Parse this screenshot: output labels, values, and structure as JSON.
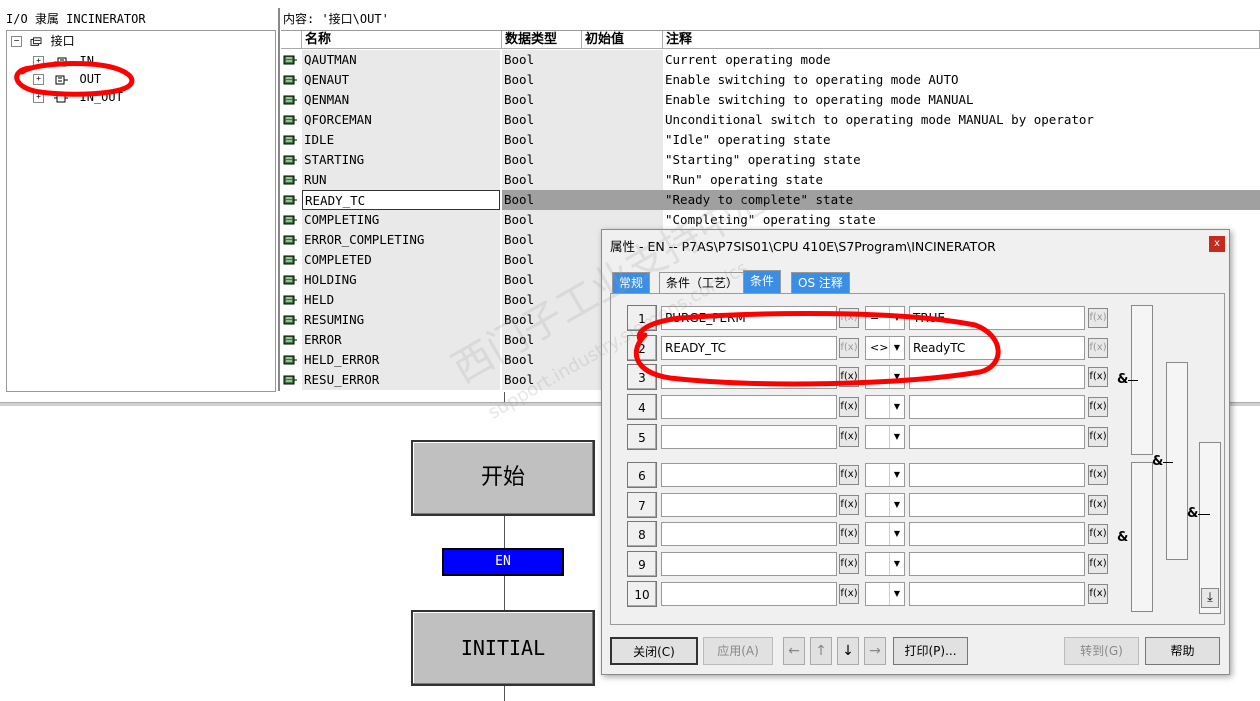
{
  "tree": {
    "header": "I/O 隶属 INCINERATOR",
    "root": "接口",
    "items": [
      "IN",
      "OUT",
      "IN_OUT"
    ]
  },
  "table": {
    "header": "内容: '接口\\OUT'",
    "columns": [
      "名称",
      "数据类型",
      "初始值",
      "注释"
    ],
    "rows": [
      {
        "name": "QAUTMAN",
        "type": "Bool",
        "init": "",
        "comment": "Current operating mode"
      },
      {
        "name": "QENAUT",
        "type": "Bool",
        "init": "",
        "comment": "Enable switching to operating mode AUTO"
      },
      {
        "name": "QENMAN",
        "type": "Bool",
        "init": "",
        "comment": "Enable switching to operating mode MANUAL"
      },
      {
        "name": "QFORCEMAN",
        "type": "Bool",
        "init": "",
        "comment": "Unconditional switch to operating mode MANUAL by operator"
      },
      {
        "name": "IDLE",
        "type": "Bool",
        "init": "",
        "comment": "\"Idle\" operating state"
      },
      {
        "name": "STARTING",
        "type": "Bool",
        "init": "",
        "comment": "\"Starting\" operating state"
      },
      {
        "name": "RUN",
        "type": "Bool",
        "init": "",
        "comment": "\"Run\" operating state"
      },
      {
        "name": "READY_TC",
        "type": "Bool",
        "init": "",
        "comment": "\"Ready to complete\" state"
      },
      {
        "name": "COMPLETING",
        "type": "Bool",
        "init": "",
        "comment": "\"Completing\" operating state"
      },
      {
        "name": "ERROR_COMPLETING",
        "type": "Bool",
        "init": "",
        "comment": ""
      },
      {
        "name": "COMPLETED",
        "type": "Bool",
        "init": "",
        "comment": ""
      },
      {
        "name": "HOLDING",
        "type": "Bool",
        "init": "",
        "comment": ""
      },
      {
        "name": "HELD",
        "type": "Bool",
        "init": "",
        "comment": ""
      },
      {
        "name": "RESUMING",
        "type": "Bool",
        "init": "",
        "comment": ""
      },
      {
        "name": "ERROR",
        "type": "Bool",
        "init": "",
        "comment": ""
      },
      {
        "name": "HELD_ERROR",
        "type": "Bool",
        "init": "",
        "comment": ""
      },
      {
        "name": "RESU_ERROR",
        "type": "Bool",
        "init": "",
        "comment": ""
      }
    ]
  },
  "sfc": {
    "step_start": "开始",
    "transition": "EN",
    "step_initial": "INITIAL"
  },
  "dialog": {
    "title": "属性 -  EN -- P7AS\\P7SIS01\\CPU 410E\\S7Program\\INCINERATOR",
    "close": "x",
    "tabs": [
      "常规",
      "条件（工艺）",
      "条件",
      "OS 注释"
    ],
    "rows": [
      {
        "num": "1",
        "left": "PURGE_PERM",
        "op": "=",
        "right": "TRUE"
      },
      {
        "num": "2",
        "left": "READY_TC",
        "op": "<>",
        "right": "ReadyTC"
      },
      {
        "num": "3",
        "left": "",
        "op": "",
        "right": ""
      },
      {
        "num": "4",
        "left": "",
        "op": "",
        "right": ""
      },
      {
        "num": "5",
        "left": "",
        "op": "",
        "right": ""
      },
      {
        "num": "6",
        "left": "",
        "op": "",
        "right": ""
      },
      {
        "num": "7",
        "left": "",
        "op": "",
        "right": ""
      },
      {
        "num": "8",
        "left": "",
        "op": "",
        "right": ""
      },
      {
        "num": "9",
        "left": "",
        "op": "",
        "right": ""
      },
      {
        "num": "10",
        "left": "",
        "op": "",
        "right": ""
      }
    ],
    "fx_label": "f(x)",
    "and_label": "&",
    "buttons": {
      "close": "关闭(C)",
      "apply": "应用(A)",
      "print": "打印(P)...",
      "goto": "转到(G)",
      "help": "帮助"
    },
    "nav_arrows": [
      "←",
      "↑",
      "↓",
      "→"
    ]
  },
  "watermark": {
    "text": "西门子工业支持中心",
    "url": "support.industry.siemens.com/cs"
  },
  "colors": {
    "transition_fill": "#0000ff",
    "selected_row": "#a0a0a0",
    "annotation_red": "#ff0000",
    "close_button": "#c42b1c"
  }
}
